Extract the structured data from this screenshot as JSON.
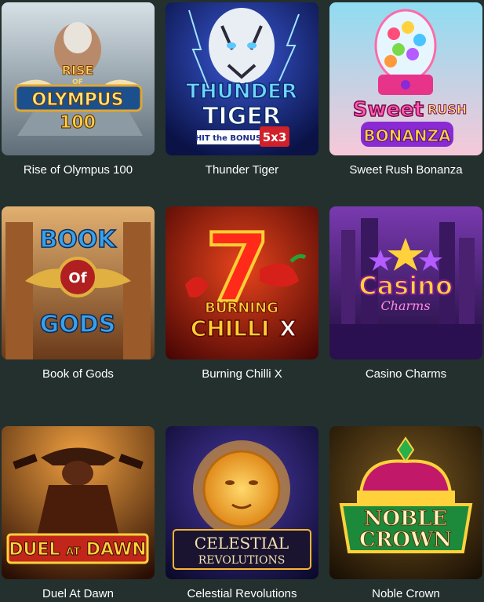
{
  "games": [
    {
      "title": "Rise of Olympus 100",
      "logo_lines": [
        "RISE",
        "OF",
        "OLYMPUS",
        "100"
      ],
      "colors": {
        "bg1": "#c7d3da",
        "bg2": "#6f7f8a",
        "accent": "#e0a630",
        "plate": "#1c4f8e"
      }
    },
    {
      "title": "Thunder Tiger",
      "logo_lines": [
        "THUNDER",
        "TIGER",
        "HIT the BONUS",
        "5x3"
      ],
      "colors": {
        "bg1": "#1a2d8a",
        "bg2": "#0a1246",
        "accent": "#5bc8ff",
        "plate": "#d0202a"
      }
    },
    {
      "title": "Sweet Rush Bonanza",
      "logo_lines": [
        "Sweet",
        "RUSH",
        "BONANZA"
      ],
      "colors": {
        "bg1": "#7fd6f0",
        "bg2": "#f3c4d6",
        "accent": "#e8338a",
        "plate": "#ffd23c"
      }
    },
    {
      "title": "Book of Gods",
      "logo_lines": [
        "BOOK",
        "Of",
        "GODS"
      ],
      "colors": {
        "bg1": "#d7a560",
        "bg2": "#6a3a1a",
        "accent": "#2a8fd4",
        "plate": "#b02020"
      }
    },
    {
      "title": "Burning Chilli X",
      "logo_lines": [
        "7",
        "BURNING",
        "CHILLI",
        "X"
      ],
      "colors": {
        "bg1": "#c8281c",
        "bg2": "#5a0804",
        "accent": "#ffcf33",
        "plate": "#e33b16"
      }
    },
    {
      "title": "Casino Charms",
      "logo_lines": [
        "Casino",
        "Charms"
      ],
      "colors": {
        "bg1": "#6a2fa0",
        "bg2": "#1c0c3a",
        "accent": "#ffd23c",
        "plate": "#e055d6"
      }
    },
    {
      "title": "Duel At Dawn",
      "logo_lines": [
        "DUEL",
        "AT",
        "DAWN"
      ],
      "colors": {
        "bg1": "#e08a2a",
        "bg2": "#3a1406",
        "accent": "#ffd23c",
        "plate": "#c2261a"
      }
    },
    {
      "title": "Celestial Revolutions",
      "logo_lines": [
        "CELESTIAL",
        "REVOLUTIONS"
      ],
      "colors": {
        "bg1": "#3a2a8a",
        "bg2": "#0c0a2c",
        "accent": "#ffb62e",
        "plate": "#1a1430"
      }
    },
    {
      "title": "Noble Crown",
      "logo_lines": [
        "NOBLE",
        "CROWN"
      ],
      "colors": {
        "bg1": "#6a4a1a",
        "bg2": "#1c1206",
        "accent": "#ffd23c",
        "plate": "#1c8a3a"
      }
    }
  ]
}
